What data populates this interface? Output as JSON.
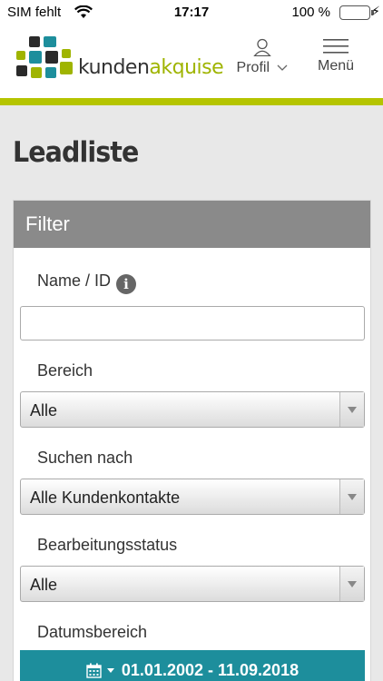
{
  "status_bar": {
    "carrier": "SIM fehlt",
    "time": "17:17",
    "battery_percent": "100 %",
    "battery_level": 1.0
  },
  "header": {
    "logo_part1": "kunden",
    "logo_part2": "akquise",
    "profile_label": "Profil",
    "menu_label": "Menü"
  },
  "page": {
    "title": "Leadliste"
  },
  "filter": {
    "heading": "Filter",
    "name_label": "Name / ID",
    "name_value": "",
    "bereich_label": "Bereich",
    "bereich_value": "Alle",
    "suchen_label": "Suchen nach",
    "suchen_value": "Alle Kundenkontakte",
    "status_label": "Bearbeitungsstatus",
    "status_value": "Alle",
    "datum_label": "Datumsbereich",
    "datum_value": "01.01.2002 - 11.09.2018"
  },
  "colors": {
    "brand_green": "#b5c400",
    "date_button": "#1d8e9c",
    "panel_header": "#8a8a8a"
  }
}
